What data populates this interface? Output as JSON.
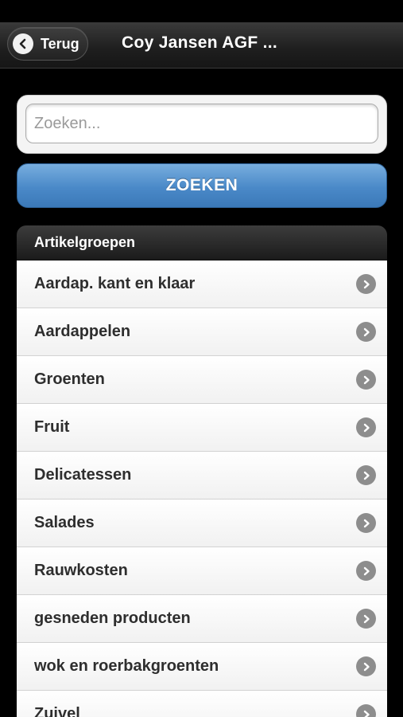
{
  "header": {
    "back_label": "Terug",
    "title": "Coy Jansen AGF ..."
  },
  "search": {
    "placeholder": "Zoeken...",
    "value": "",
    "button_label": "ZOEKEN"
  },
  "groups": {
    "heading": "Artikelgroepen",
    "items": [
      {
        "label": "Aardap. kant en klaar"
      },
      {
        "label": "Aardappelen"
      },
      {
        "label": "Groenten"
      },
      {
        "label": "Fruit"
      },
      {
        "label": "Delicatessen"
      },
      {
        "label": "Salades"
      },
      {
        "label": "Rauwkosten"
      },
      {
        "label": "gesneden producten"
      },
      {
        "label": "wok en roerbakgroenten"
      },
      {
        "label": "Zuivel"
      }
    ]
  },
  "colors": {
    "button_blue": "#4a89c8",
    "header_dark": "#1e1e1e",
    "chevron_gray": "#8d8d8d"
  }
}
